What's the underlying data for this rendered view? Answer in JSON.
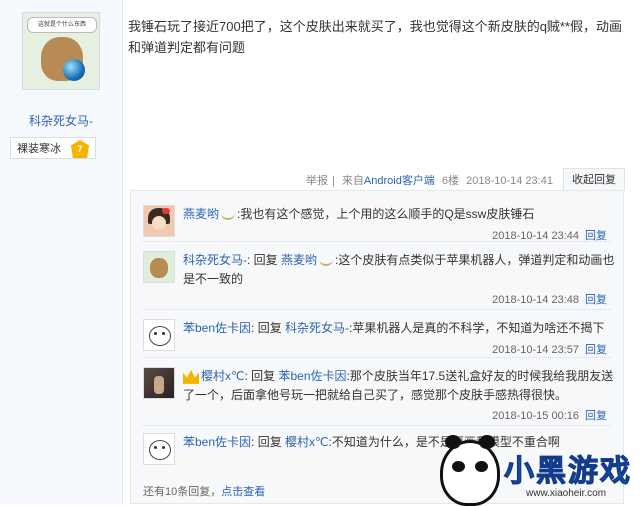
{
  "author": {
    "avatar_caption": "这就是个什么东西",
    "name": "科杂死女马-",
    "badge_label": "裸装寒冰",
    "badge_level": "7"
  },
  "post": {
    "text": "我锤石玩了接近700把了，这个皮肤出来就买了，我也觉得这个新皮肤的q贼**假，动画和弹道判定都有问题",
    "report": "举报",
    "source_prefix": "来自",
    "source": "Android客户端",
    "floor": "6楼",
    "time": "2018-10-14 23:41",
    "fold_reply": "收起回复",
    "separator": "|"
  },
  "replies": [
    {
      "user": "燕麦哟",
      "reply_prefix": "",
      "reply_to": "",
      "text": ":我也有这个感觉，上个用的这么顺手的Q是ssw皮肤锤石",
      "time": "2018-10-14 23:44",
      "reply_label": "回复"
    },
    {
      "user": "科杂死女马-",
      "reply_prefix": ": 回复 ",
      "reply_to": "燕麦哟",
      "text": ":这个皮肤有点类似于苹果机器人，弹道判定和动画也是不一致的",
      "time": "2018-10-14 23:48",
      "reply_label": "回复"
    },
    {
      "user": "苯ben佐卡因",
      "reply_prefix": ": 回复 ",
      "reply_to": "科杂死女马-",
      "text": ":苹果机器人是真的不科学，不知道为啥还不揭下",
      "time": "2018-10-14 23:57",
      "reply_label": "回复"
    },
    {
      "user": "樱村x℃",
      "reply_prefix": ": 回复 ",
      "reply_to": "苯ben佐卡因",
      "text": ":那个皮肤当年17.5送礼盒好友的时候我给我朋友送了一个，后面拿他号玩一把就给自己买了，感觉那个皮肤手感热得很快。",
      "time": "2018-10-15 00:16",
      "reply_label": "回复"
    },
    {
      "user": "苯ben佐卡因",
      "reply_prefix": ": 回复 ",
      "reply_to": "樱村x℃",
      "text": ":不知道为什么，是不是原画和模型不重合啊",
      "time": "",
      "reply_label": ""
    }
  ],
  "more": {
    "count_text": "还有10条回复，",
    "link": "点击查看"
  },
  "watermark": {
    "title": "小黑游戏",
    "url": "www.xiaoheir.com"
  }
}
